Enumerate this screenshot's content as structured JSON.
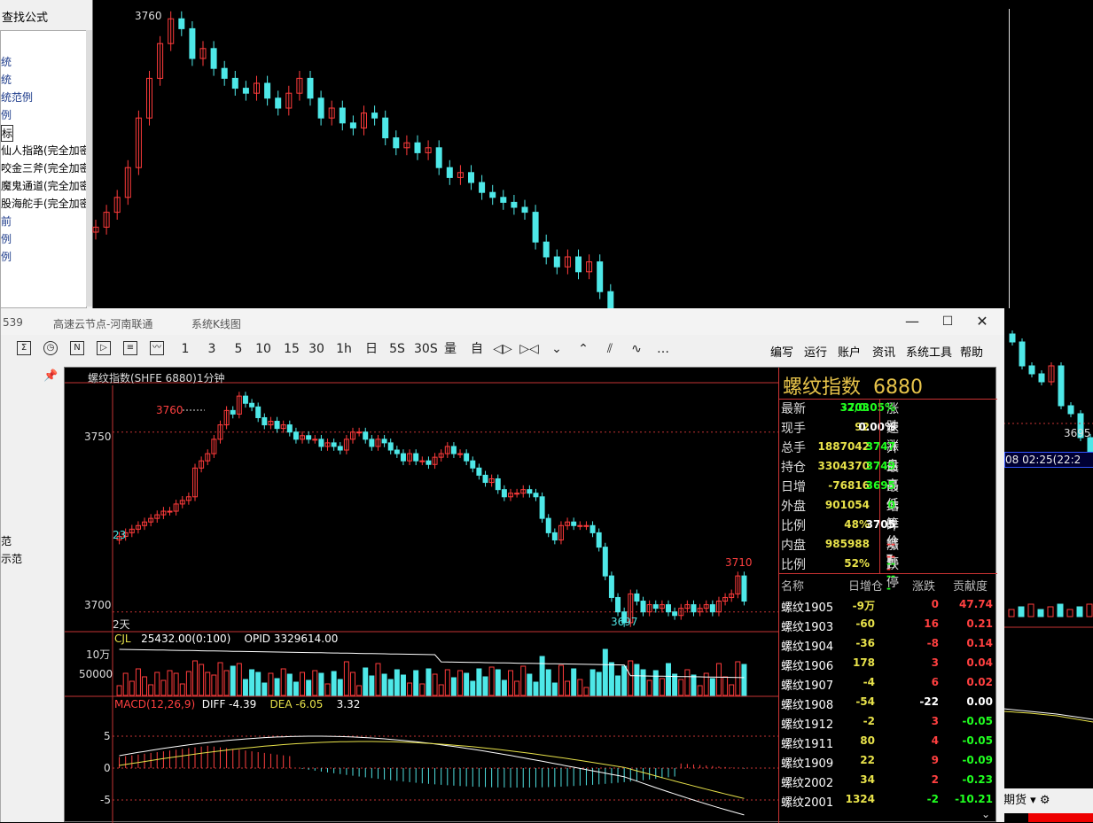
{
  "left_panel": {
    "title": "查找公式",
    "items": [
      {
        "label": "统",
        "style": "link"
      },
      {
        "label": "统",
        "style": "link"
      },
      {
        "label": "统范例",
        "style": "link"
      },
      {
        "label": "例",
        "style": "link"
      },
      {
        "label": "标",
        "style": "selected"
      },
      {
        "label": "仙人指路(完全加密",
        "style": "plain"
      },
      {
        "label": "咬金三斧(完全加密",
        "style": "plain"
      },
      {
        "label": "魔鬼通道(完全加密",
        "style": "plain"
      },
      {
        "label": "股海舵手(完全加密",
        "style": "plain"
      },
      {
        "label": "前",
        "style": "link"
      },
      {
        "label": "例",
        "style": "link"
      },
      {
        "label": "例",
        "style": "link"
      }
    ]
  },
  "bg_chart": {
    "high_label": "3760",
    "low_label": "3695",
    "time_label": "08 02:25(22:2",
    "future_label": "期货 ▾"
  },
  "window": {
    "title_version": "539",
    "title_server": "高速云节点-河南联通",
    "title_product": "系统K线图",
    "controls": [
      "—",
      "☐",
      "✕"
    ]
  },
  "toolbar": {
    "periods": [
      "1",
      "3",
      "5",
      "10",
      "15",
      "30",
      "1h",
      "日",
      "5S",
      "30S",
      "量",
      "自"
    ],
    "menus": [
      "编写",
      "运行",
      "账户",
      "资讯",
      "系统工具",
      "帮助"
    ],
    "more": "…"
  },
  "sidebar2": {
    "items": [
      "范",
      "示范"
    ]
  },
  "chart": {
    "header": "螺纹指数(SHFE 6880)1分钟",
    "y_labels": [
      "3750",
      "3700"
    ],
    "high": "3760",
    "low": "3697",
    "right_price": "3710",
    "left_small": "23",
    "days": "2天",
    "vol_header": {
      "name": "CJL",
      "value": "25432.00(0:100)",
      "opid": "OPID 3329614.00"
    },
    "vol_y": [
      "10万",
      "50000"
    ],
    "macd_header": {
      "name": "MACD(12,26,9)",
      "diff": "DIFF -4.39",
      "dea": "DEA -6.05",
      "macd": "3.32"
    },
    "macd_y": [
      "5",
      "0",
      "-5"
    ]
  },
  "chart_data": {
    "type": "candlestick",
    "title": "螺纹指数(SHFE 6880)1分钟",
    "ylim": [
      3695,
      3762
    ],
    "close": [
      3721,
      3722,
      3723,
      3724,
      3725,
      3726,
      3727,
      3728,
      3728,
      3730,
      3731,
      3732,
      3740,
      3742,
      3744,
      3748,
      3752,
      3756,
      3755,
      3760,
      3758,
      3757,
      3754,
      3752,
      3753,
      3751,
      3752,
      3750,
      3748,
      3749,
      3748,
      3748,
      3746,
      3747,
      3746,
      3745,
      3748,
      3750,
      3750,
      3748,
      3746,
      3748,
      3747,
      3745,
      3744,
      3742,
      3744,
      3742,
      3742,
      3741,
      3743,
      3744,
      3746,
      3744,
      3744,
      3742,
      3740,
      3738,
      3736,
      3737,
      3734,
      3732,
      3733,
      3733,
      3734,
      3733,
      3732,
      3726,
      3722,
      3720,
      3724,
      3725,
      3724,
      3724,
      3724,
      3722,
      3718,
      3710,
      3704,
      3700,
      3697,
      3705,
      3703,
      3700,
      3702,
      3701,
      3702,
      3700,
      3699,
      3701,
      3702,
      3700,
      3701,
      3702,
      3700,
      3703,
      3704,
      3705,
      3710,
      3703
    ]
  },
  "quote": {
    "name": "螺纹指数",
    "code": "6880",
    "left": [
      {
        "label": "最新",
        "value": "3703",
        "color": "green"
      },
      {
        "label": "现手",
        "value": "92",
        "color": "yellow"
      },
      {
        "label": "总手",
        "value": "1887042",
        "color": "yellow"
      },
      {
        "label": "持仓",
        "value": "3304370",
        "color": "yellow"
      },
      {
        "label": "日增",
        "value": "-76816",
        "color": "yellow"
      },
      {
        "label": "外盘",
        "value": "901054",
        "color": "yellow"
      },
      {
        "label": "比例",
        "value": "48%",
        "color": "yellow"
      },
      {
        "label": "内盘",
        "value": "985988",
        "color": "yellow"
      },
      {
        "label": "比例",
        "value": "52%",
        "color": "yellow"
      }
    ],
    "right": [
      {
        "label": "涨跌",
        "value": "-2/0.05%",
        "color": "green"
      },
      {
        "label": "速涨",
        "value": "0.00%",
        "color": "white"
      },
      {
        "label": "开盘",
        "value": "3747",
        "color": "green"
      },
      {
        "label": "最高",
        "value": "3749",
        "color": "green"
      },
      {
        "label": "最低",
        "value": "3695",
        "color": "green"
      },
      {
        "label": "结算价▾",
        "value": "0",
        "color": "green"
      },
      {
        "label": "昨结▾",
        "value": "3705",
        "color": "white"
      },
      {
        "label": "涨停",
        "value": "-----",
        "color": "red"
      },
      {
        "label": "跌停",
        "value": "-----",
        "color": "green"
      }
    ],
    "table_headers": [
      "名称",
      "日增仓",
      "涨跌",
      "贡献度"
    ],
    "rows": [
      {
        "name": "螺纹1905",
        "inc": "-9万",
        "chg": "0",
        "contrib": "47.74",
        "chgc": "red",
        "cc": "red"
      },
      {
        "name": "螺纹1903",
        "inc": "-60",
        "chg": "16",
        "contrib": "0.21",
        "chgc": "red",
        "cc": "red"
      },
      {
        "name": "螺纹1904",
        "inc": "-36",
        "chg": "-8",
        "contrib": "0.14",
        "chgc": "red",
        "cc": "red"
      },
      {
        "name": "螺纹1906",
        "inc": "178",
        "chg": "3",
        "contrib": "0.04",
        "chgc": "red",
        "cc": "red"
      },
      {
        "name": "螺纹1907",
        "inc": "-4",
        "chg": "6",
        "contrib": "0.02",
        "chgc": "red",
        "cc": "red"
      },
      {
        "name": "螺纹1908",
        "inc": "-54",
        "chg": "-22",
        "contrib": "0.00",
        "chgc": "white",
        "cc": "white"
      },
      {
        "name": "螺纹1912",
        "inc": "-2",
        "chg": "3",
        "contrib": "-0.05",
        "chgc": "red",
        "cc": "green"
      },
      {
        "name": "螺纹1911",
        "inc": "80",
        "chg": "4",
        "contrib": "-0.05",
        "chgc": "red",
        "cc": "green"
      },
      {
        "name": "螺纹1909",
        "inc": "22",
        "chg": "9",
        "contrib": "-0.09",
        "chgc": "red",
        "cc": "green"
      },
      {
        "name": "螺纹2002",
        "inc": "34",
        "chg": "2",
        "contrib": "-0.23",
        "chgc": "red",
        "cc": "green"
      },
      {
        "name": "螺纹2001",
        "inc": "1324",
        "chg": "-2",
        "contrib": "-10.21",
        "chgc": "green",
        "cc": "green"
      }
    ]
  },
  "colors": {
    "up": "#ff3b3b",
    "down": "#4ee8e8",
    "grid": "#c33333",
    "macd_up": "#ff4040",
    "macd_down": "#4ee0e0"
  }
}
